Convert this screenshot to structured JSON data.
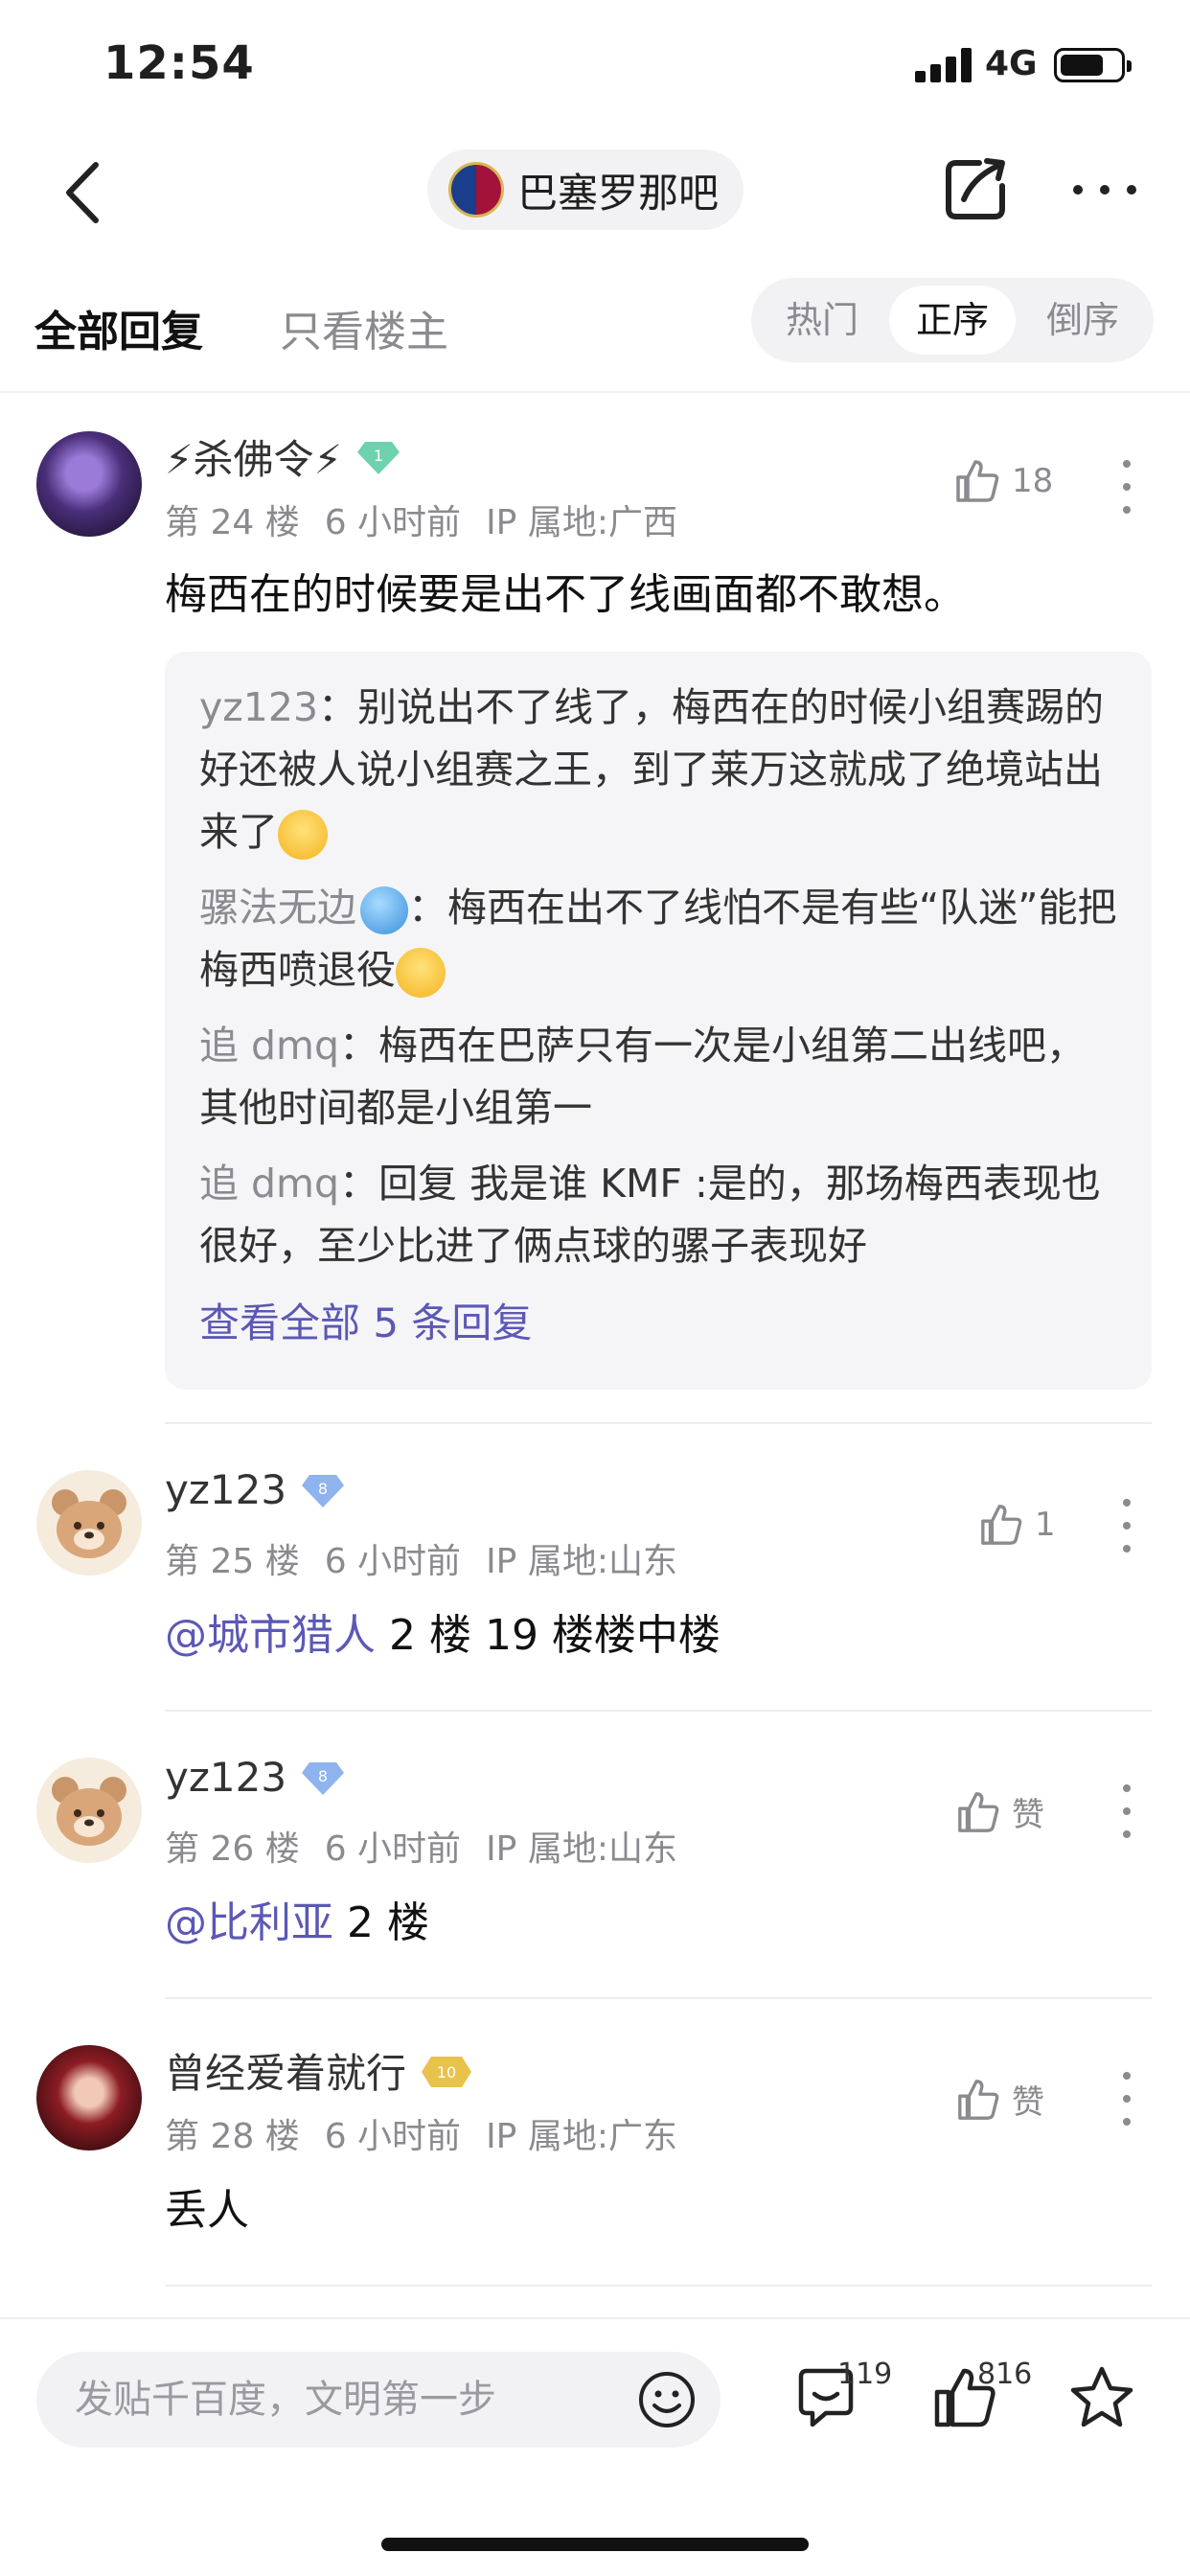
{
  "status_bar": {
    "time": "12:54",
    "network": "4G"
  },
  "nav": {
    "forum_name": "巴塞罗那吧"
  },
  "filter": {
    "tab_all": "全部回复",
    "tab_owner": "只看楼主",
    "sort": [
      "热门",
      "正序",
      "倒序"
    ],
    "sort_selected": "正序"
  },
  "posts": [
    {
      "username": "⚡杀佛令⚡",
      "level": "1",
      "floor": "第 24 楼",
      "time": "6 小时前",
      "ip": "IP 属地:广西",
      "likes": "18",
      "content": "梅西在的时候要是出不了线画面都不敢想。",
      "replies": [
        {
          "who": "yz123",
          "text": "别说出不了线了，梅西在的时候小组赛踢的好还被人说小组赛之王，到了莱万这就成了绝境站出来了"
        },
        {
          "who": "骡法无边",
          "text": "梅西在出不了线怕不是有些“队迷”能把梅西喷退役"
        },
        {
          "who": "追 dmq",
          "text": "梅西在巴萨只有一次是小组第二出线吧，其他时间都是小组第一"
        },
        {
          "who": "追 dmq",
          "text": "回复 我是谁 KMF :是的，那场梅西表现也很好，至少比进了俩点球的骡子表现好"
        }
      ],
      "view_all": "查看全部 5 条回复"
    },
    {
      "username": "yz123",
      "level": "8",
      "floor": "第 25 楼",
      "time": "6 小时前",
      "ip": "IP 属地:山东",
      "likes": "1",
      "mention": "@城市猎人",
      "content": " 2 楼 19 楼楼中楼"
    },
    {
      "username": "yz123",
      "level": "8",
      "floor": "第 26 楼",
      "time": "6 小时前",
      "ip": "IP 属地:山东",
      "likes": "赞",
      "mention": "@比利亚",
      "content": " 2 楼"
    },
    {
      "username": "曾经爱着就行",
      "level": "10",
      "floor": "第 28 楼",
      "time": "6 小时前",
      "ip": "IP 属地:广东",
      "likes": "赞",
      "content": "丢人"
    }
  ],
  "bottom": {
    "placeholder": "发贴千百度，文明第一步",
    "comments": "119",
    "likes": "816"
  }
}
